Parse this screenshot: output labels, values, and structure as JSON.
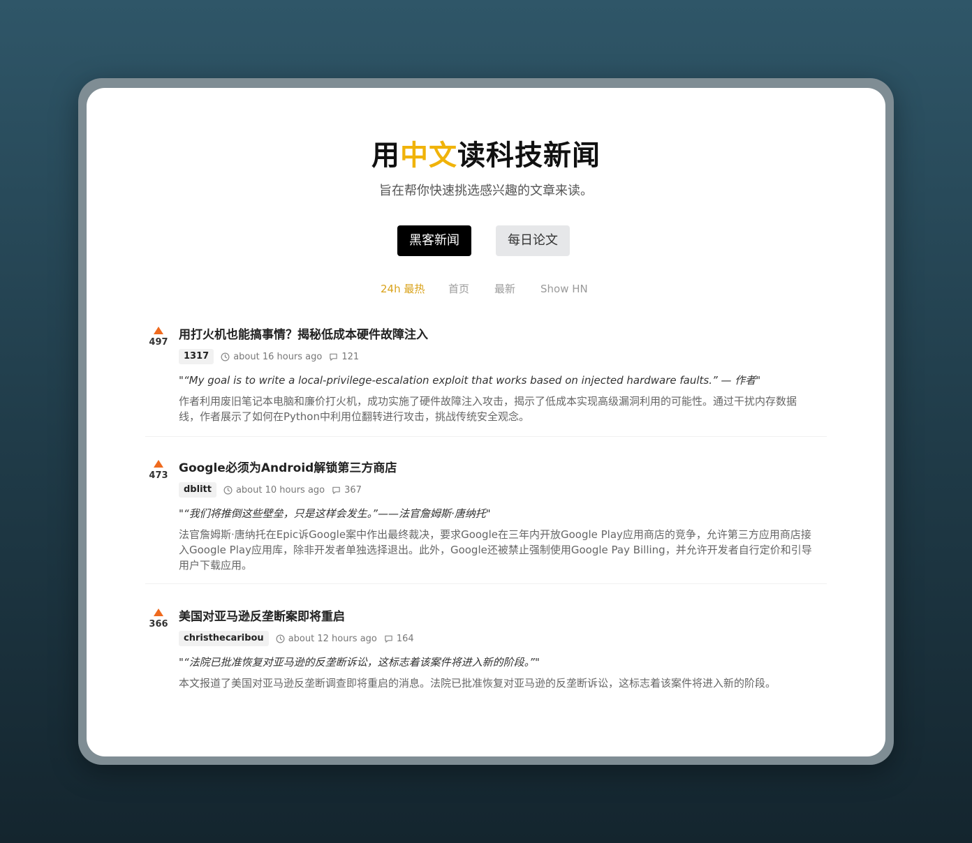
{
  "hero": {
    "title_prefix": "用",
    "title_accent": "中文",
    "title_suffix": "读科技新闻",
    "subtitle": "旨在帮你快速挑选感兴趣的文章来读。"
  },
  "source_buttons": {
    "primary": "黑客新闻",
    "secondary": "每日论文"
  },
  "tabs": [
    {
      "label": "24h 最热",
      "active": true
    },
    {
      "label": "首页",
      "active": false
    },
    {
      "label": "最新",
      "active": false
    },
    {
      "label": "Show HN",
      "active": false
    }
  ],
  "posts": [
    {
      "score": "497",
      "title": "用打火机也能搞事情？揭秘低成本硬件故障注入",
      "author": "1317",
      "time": "about 16 hours ago",
      "comments": "121",
      "quote": "\"“My goal is to write a local-privilege-escalation exploit that works based on injected hardware faults.” — 作者\"",
      "summary": "作者利用废旧笔记本电脑和廉价打火机，成功实施了硬件故障注入攻击，揭示了低成本实现高级漏洞利用的可能性。通过干扰内存数据线，作者展示了如何在Python中利用位翻转进行攻击，挑战传统安全观念。"
    },
    {
      "score": "473",
      "title": "Google必须为Android解锁第三方商店",
      "author": "dblitt",
      "time": "about 10 hours ago",
      "comments": "367",
      "quote": "\"“我们将推倒这些壁垒，只是这样会发生。”——法官詹姆斯·唐纳托\"",
      "summary": "法官詹姆斯·唐纳托在Epic诉Google案中作出最终裁决，要求Google在三年内开放Google Play应用商店的竞争，允许第三方应用商店接入Google Play应用库，除非开发者单独选择退出。此外，Google还被禁止强制使用Google Pay Billing，并允许开发者自行定价和引导用户下载应用。"
    },
    {
      "score": "366",
      "title": "美国对亚马逊反垄断案即将重启",
      "author": "christhecaribou",
      "time": "about 12 hours ago",
      "comments": "164",
      "quote": "\"“法院已批准恢复对亚马逊的反垄断诉讼，这标志着该案件将进入新的阶段。”\"",
      "summary": "本文报道了美国对亚马逊反垄断调查即将重启的消息。法院已批准恢复对亚马逊的反垄断诉讼，这标志着该案件将进入新的阶段。"
    }
  ],
  "colors": {
    "accent": "#f0b30a",
    "active_tab": "#d9a21a",
    "upvote": "#ef6a1e",
    "primary_button": "#000000",
    "secondary_button": "#e6e7e9"
  },
  "icons": {
    "upvote": "triangle-up-icon",
    "time": "clock-icon",
    "comments": "comment-bubble-icon"
  }
}
